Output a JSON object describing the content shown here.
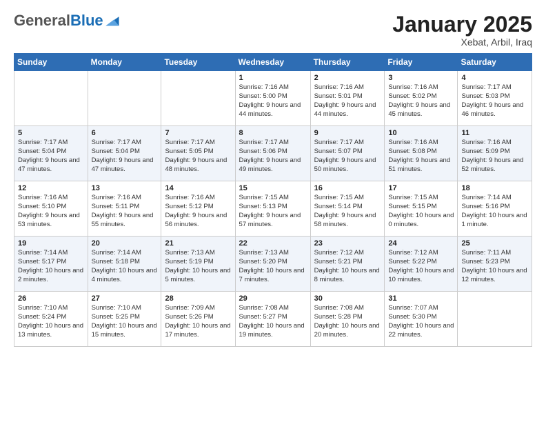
{
  "header": {
    "logo_general": "General",
    "logo_blue": "Blue",
    "month_title": "January 2025",
    "location": "Xebat, Arbil, Iraq"
  },
  "weekdays": [
    "Sunday",
    "Monday",
    "Tuesday",
    "Wednesday",
    "Thursday",
    "Friday",
    "Saturday"
  ],
  "weeks": [
    [
      {
        "day": "",
        "text": ""
      },
      {
        "day": "",
        "text": ""
      },
      {
        "day": "",
        "text": ""
      },
      {
        "day": "1",
        "text": "Sunrise: 7:16 AM\nSunset: 5:00 PM\nDaylight: 9 hours\nand 44 minutes."
      },
      {
        "day": "2",
        "text": "Sunrise: 7:16 AM\nSunset: 5:01 PM\nDaylight: 9 hours\nand 44 minutes."
      },
      {
        "day": "3",
        "text": "Sunrise: 7:16 AM\nSunset: 5:02 PM\nDaylight: 9 hours\nand 45 minutes."
      },
      {
        "day": "4",
        "text": "Sunrise: 7:17 AM\nSunset: 5:03 PM\nDaylight: 9 hours\nand 46 minutes."
      }
    ],
    [
      {
        "day": "5",
        "text": "Sunrise: 7:17 AM\nSunset: 5:04 PM\nDaylight: 9 hours\nand 47 minutes."
      },
      {
        "day": "6",
        "text": "Sunrise: 7:17 AM\nSunset: 5:04 PM\nDaylight: 9 hours\nand 47 minutes."
      },
      {
        "day": "7",
        "text": "Sunrise: 7:17 AM\nSunset: 5:05 PM\nDaylight: 9 hours\nand 48 minutes."
      },
      {
        "day": "8",
        "text": "Sunrise: 7:17 AM\nSunset: 5:06 PM\nDaylight: 9 hours\nand 49 minutes."
      },
      {
        "day": "9",
        "text": "Sunrise: 7:17 AM\nSunset: 5:07 PM\nDaylight: 9 hours\nand 50 minutes."
      },
      {
        "day": "10",
        "text": "Sunrise: 7:16 AM\nSunset: 5:08 PM\nDaylight: 9 hours\nand 51 minutes."
      },
      {
        "day": "11",
        "text": "Sunrise: 7:16 AM\nSunset: 5:09 PM\nDaylight: 9 hours\nand 52 minutes."
      }
    ],
    [
      {
        "day": "12",
        "text": "Sunrise: 7:16 AM\nSunset: 5:10 PM\nDaylight: 9 hours\nand 53 minutes."
      },
      {
        "day": "13",
        "text": "Sunrise: 7:16 AM\nSunset: 5:11 PM\nDaylight: 9 hours\nand 55 minutes."
      },
      {
        "day": "14",
        "text": "Sunrise: 7:16 AM\nSunset: 5:12 PM\nDaylight: 9 hours\nand 56 minutes."
      },
      {
        "day": "15",
        "text": "Sunrise: 7:15 AM\nSunset: 5:13 PM\nDaylight: 9 hours\nand 57 minutes."
      },
      {
        "day": "16",
        "text": "Sunrise: 7:15 AM\nSunset: 5:14 PM\nDaylight: 9 hours\nand 58 minutes."
      },
      {
        "day": "17",
        "text": "Sunrise: 7:15 AM\nSunset: 5:15 PM\nDaylight: 10 hours\nand 0 minutes."
      },
      {
        "day": "18",
        "text": "Sunrise: 7:14 AM\nSunset: 5:16 PM\nDaylight: 10 hours\nand 1 minute."
      }
    ],
    [
      {
        "day": "19",
        "text": "Sunrise: 7:14 AM\nSunset: 5:17 PM\nDaylight: 10 hours\nand 2 minutes."
      },
      {
        "day": "20",
        "text": "Sunrise: 7:14 AM\nSunset: 5:18 PM\nDaylight: 10 hours\nand 4 minutes."
      },
      {
        "day": "21",
        "text": "Sunrise: 7:13 AM\nSunset: 5:19 PM\nDaylight: 10 hours\nand 5 minutes."
      },
      {
        "day": "22",
        "text": "Sunrise: 7:13 AM\nSunset: 5:20 PM\nDaylight: 10 hours\nand 7 minutes."
      },
      {
        "day": "23",
        "text": "Sunrise: 7:12 AM\nSunset: 5:21 PM\nDaylight: 10 hours\nand 8 minutes."
      },
      {
        "day": "24",
        "text": "Sunrise: 7:12 AM\nSunset: 5:22 PM\nDaylight: 10 hours\nand 10 minutes."
      },
      {
        "day": "25",
        "text": "Sunrise: 7:11 AM\nSunset: 5:23 PM\nDaylight: 10 hours\nand 12 minutes."
      }
    ],
    [
      {
        "day": "26",
        "text": "Sunrise: 7:10 AM\nSunset: 5:24 PM\nDaylight: 10 hours\nand 13 minutes."
      },
      {
        "day": "27",
        "text": "Sunrise: 7:10 AM\nSunset: 5:25 PM\nDaylight: 10 hours\nand 15 minutes."
      },
      {
        "day": "28",
        "text": "Sunrise: 7:09 AM\nSunset: 5:26 PM\nDaylight: 10 hours\nand 17 minutes."
      },
      {
        "day": "29",
        "text": "Sunrise: 7:08 AM\nSunset: 5:27 PM\nDaylight: 10 hours\nand 19 minutes."
      },
      {
        "day": "30",
        "text": "Sunrise: 7:08 AM\nSunset: 5:28 PM\nDaylight: 10 hours\nand 20 minutes."
      },
      {
        "day": "31",
        "text": "Sunrise: 7:07 AM\nSunset: 5:30 PM\nDaylight: 10 hours\nand 22 minutes."
      },
      {
        "day": "",
        "text": ""
      }
    ]
  ]
}
